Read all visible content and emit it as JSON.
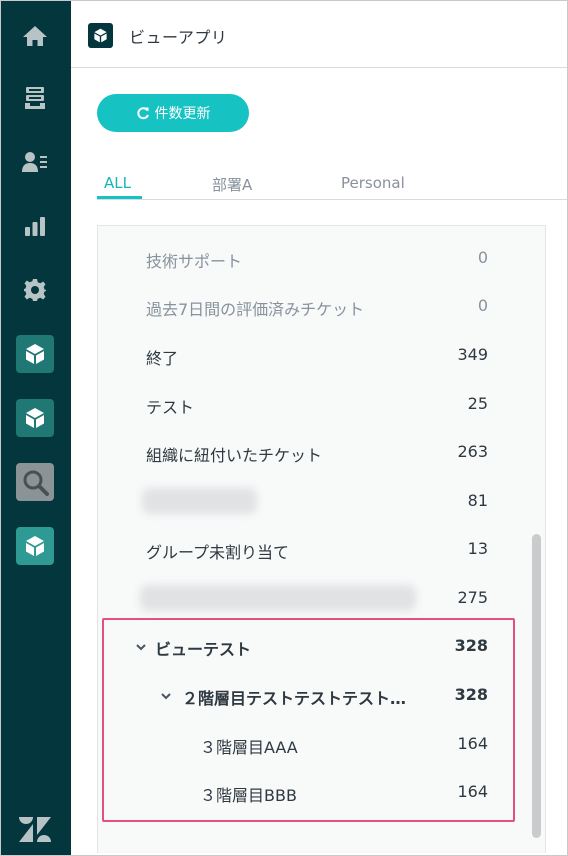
{
  "header": {
    "title": "ビューアプリ"
  },
  "toolbar": {
    "refresh_label": "件数更新"
  },
  "tabs": [
    {
      "label": "ALL",
      "active": true
    },
    {
      "label": "部署A",
      "active": false
    },
    {
      "label": "Personal",
      "active": false
    }
  ],
  "views": [
    {
      "label": "技術サポート",
      "count": "0",
      "muted": true
    },
    {
      "label": "過去7日間の評価済みチケット",
      "count": "0",
      "muted": true
    },
    {
      "label": "終了",
      "count": "349",
      "muted": false
    },
    {
      "label": "テスト",
      "count": "25",
      "muted": false
    },
    {
      "label": "組織に紐付いたチケット",
      "count": "263",
      "muted": false
    },
    {
      "label": "",
      "count": "81",
      "muted": false,
      "blurred": true
    },
    {
      "label": "グループ未割り当て",
      "count": "13",
      "muted": false
    },
    {
      "label": "",
      "count": "275",
      "muted": false,
      "blurred": true
    }
  ],
  "group": {
    "label": "ビューテスト",
    "count": "328",
    "subgroup": {
      "label": "２階層目テストテストテスト…",
      "count": "328",
      "items": [
        {
          "label": "３階層目AAA",
          "count": "164"
        },
        {
          "label": "３階層目BBB",
          "count": "164"
        }
      ]
    }
  },
  "colors": {
    "nav_bg": "#03363d",
    "accent": "#17c2c2",
    "highlight": "#e34f7f"
  },
  "icons": [
    "home-icon",
    "views-icon",
    "customers-icon",
    "reporting-icon",
    "admin-icon",
    "app-icon",
    "search-app-icon",
    "zendesk-logo"
  ]
}
